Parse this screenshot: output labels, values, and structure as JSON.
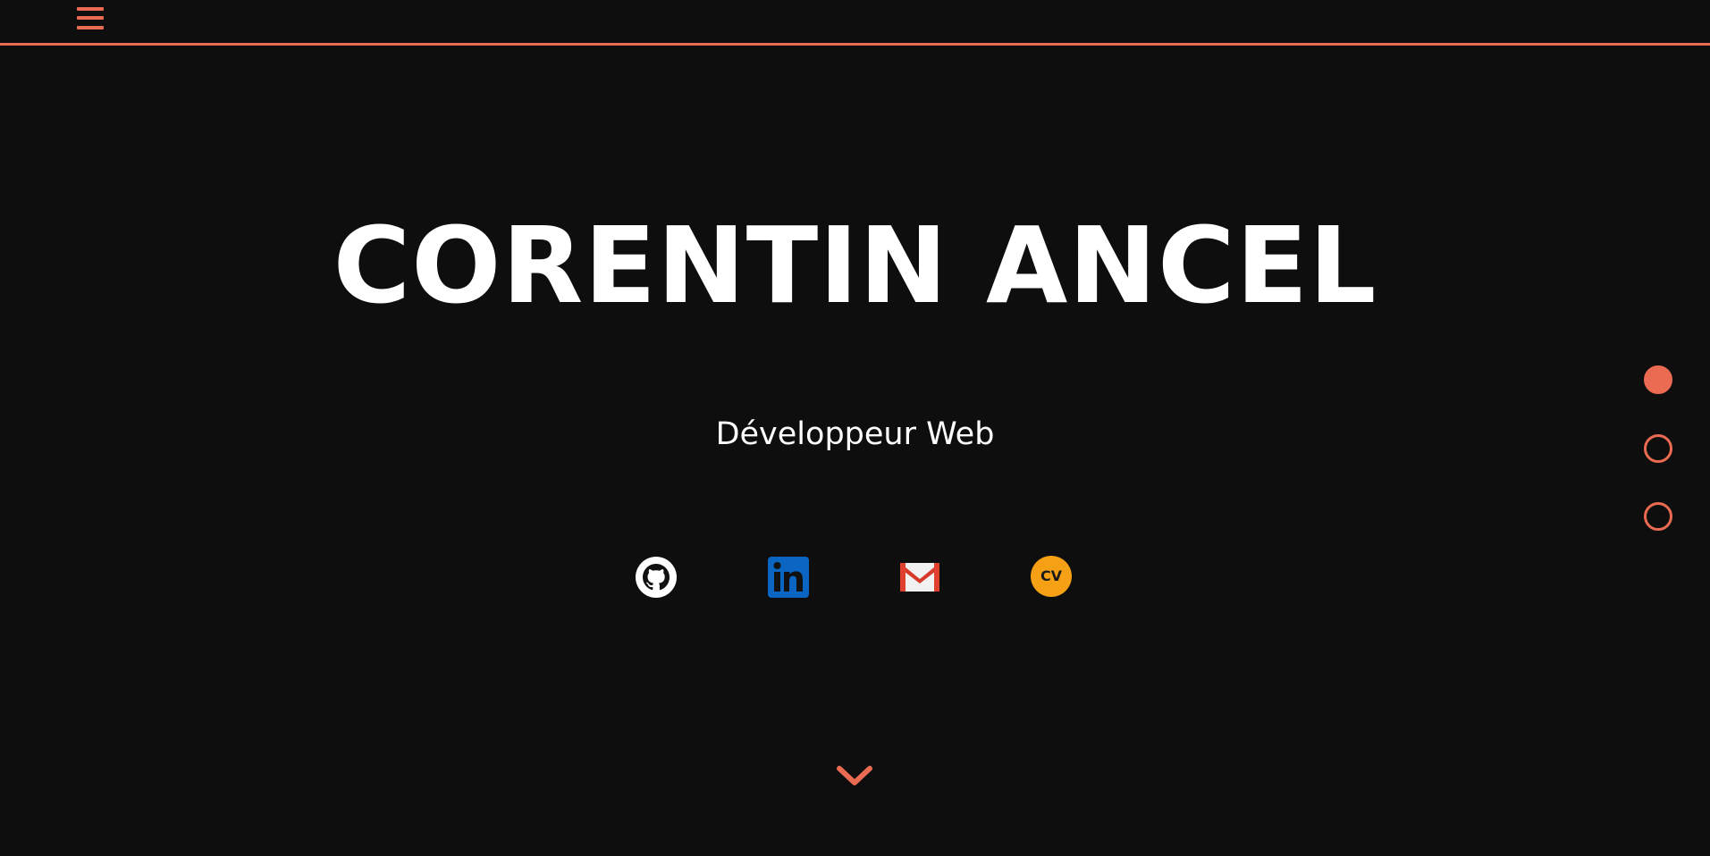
{
  "colors": {
    "background": "#0e0e0f",
    "accent": "#eb6b52",
    "text": "#ffffff",
    "linkedin": "#0a66c2",
    "cv_badge": "#f6a115",
    "gmail_red": "#e0402f"
  },
  "header": {
    "menu_icon": "hamburger-menu-icon"
  },
  "hero": {
    "title": "CORENTIN ANCEL",
    "subtitle": "Développeur Web"
  },
  "social": [
    {
      "icon": "github-icon"
    },
    {
      "icon": "linkedin-icon"
    },
    {
      "icon": "gmail-icon"
    },
    {
      "icon": "cv-icon",
      "label": "CV"
    }
  ],
  "scroll": {
    "icon": "chevron-down-icon"
  },
  "section_nav": {
    "count": 3,
    "active_index": 0
  }
}
